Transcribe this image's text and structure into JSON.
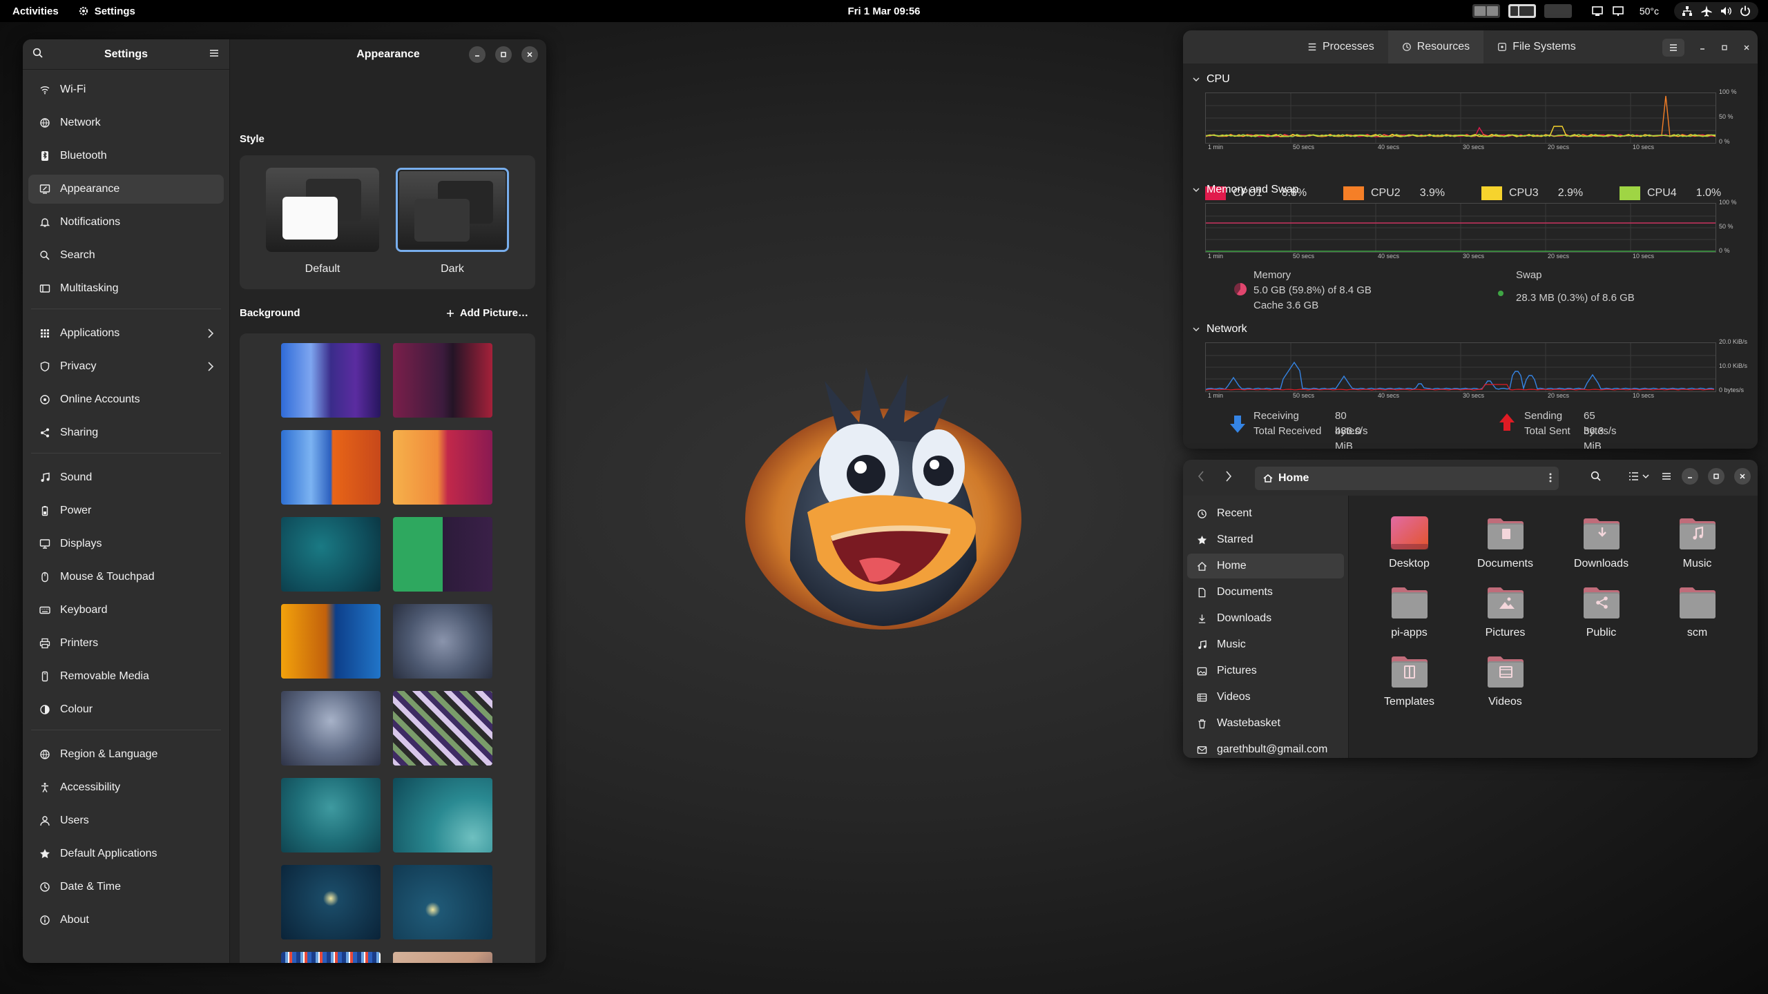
{
  "topbar": {
    "activities": "Activities",
    "app": "Settings",
    "clock": "Fri 1 Mar  09:56",
    "temp": "50°c"
  },
  "settings": {
    "sidebar_title": "Settings",
    "page_title": "Appearance",
    "sidebar": [
      {
        "label": "Wi-Fi",
        "icon": "wifi-icon"
      },
      {
        "label": "Network",
        "icon": "network-icon"
      },
      {
        "label": "Bluetooth",
        "icon": "bluetooth-icon"
      },
      {
        "label": "Appearance",
        "icon": "appearance-icon",
        "selected": true
      },
      {
        "label": "Notifications",
        "icon": "bell-icon"
      },
      {
        "label": "Search",
        "icon": "search-icon"
      },
      {
        "label": "Multitasking",
        "icon": "multitasking-icon"
      },
      {
        "label": "Applications",
        "icon": "applications-icon",
        "chevron": true
      },
      {
        "label": "Privacy",
        "icon": "privacy-icon",
        "chevron": true
      },
      {
        "label": "Online Accounts",
        "icon": "online-accounts-icon"
      },
      {
        "label": "Sharing",
        "icon": "share-icon"
      },
      {
        "label": "Sound",
        "icon": "music-note-icon"
      },
      {
        "label": "Power",
        "icon": "battery-icon"
      },
      {
        "label": "Displays",
        "icon": "display-icon"
      },
      {
        "label": "Mouse & Touchpad",
        "icon": "mouse-icon"
      },
      {
        "label": "Keyboard",
        "icon": "keyboard-icon"
      },
      {
        "label": "Printers",
        "icon": "printer-icon"
      },
      {
        "label": "Removable Media",
        "icon": "usb-icon"
      },
      {
        "label": "Colour",
        "icon": "colour-icon"
      },
      {
        "label": "Region & Language",
        "icon": "globe-icon"
      },
      {
        "label": "Accessibility",
        "icon": "accessibility-icon"
      },
      {
        "label": "Users",
        "icon": "user-icon"
      },
      {
        "label": "Default Applications",
        "icon": "star-icon"
      },
      {
        "label": "Date & Time",
        "icon": "clock-icon"
      },
      {
        "label": "About",
        "icon": "info-icon"
      }
    ],
    "style_label": "Style",
    "style_default": "Default",
    "style_dark": "Dark",
    "background_label": "Background",
    "add_picture": "Add Picture…",
    "selected_style": "Dark"
  },
  "sysmon": {
    "tabs": [
      "Processes",
      "Resources",
      "File Systems"
    ],
    "active_tab": "Resources",
    "cpu_title": "CPU",
    "mem_title": "Memory and Swap",
    "net_title": "Network",
    "pct_labels": [
      "100 %",
      "50 %",
      "0 %"
    ],
    "time_labels": [
      "1 min",
      "50 secs",
      "40 secs",
      "30 secs",
      "20 secs",
      "10 secs"
    ],
    "net_labels": [
      "20.0 KiB/s",
      "10.0 KiB/s",
      "0 bytes/s"
    ],
    "cpus": [
      {
        "name": "CPU1",
        "value": "8.8%",
        "color": "#e01b4c"
      },
      {
        "name": "CPU2",
        "value": "3.9%",
        "color": "#f57f27"
      },
      {
        "name": "CPU3",
        "value": "2.9%",
        "color": "#f6d32d"
      },
      {
        "name": "CPU4",
        "value": "1.0%",
        "color": "#9fd544"
      }
    ],
    "memory": {
      "title": "Memory",
      "line1": "5.0 GB (59.8%) of 8.4 GB",
      "line2": "Cache 3.6 GB",
      "fraction": 0.598
    },
    "swap": {
      "title": "Swap",
      "line1": "28.3 MB (0.3%) of 8.6 GB",
      "fraction": 0.003
    },
    "receiving": {
      "label": "Receiving",
      "rate": "80 bytes/s",
      "total_label": "Total Received",
      "total": "486.0 MiB"
    },
    "sending": {
      "label": "Sending",
      "rate": "65 bytes/s",
      "total_label": "Total Sent",
      "total": "36.3 MiB"
    }
  },
  "files": {
    "location": "Home",
    "sidebar": [
      {
        "label": "Recent",
        "icon": "recent-icon"
      },
      {
        "label": "Starred",
        "icon": "star-icon"
      },
      {
        "label": "Home",
        "icon": "home-icon",
        "selected": true
      },
      {
        "label": "Documents",
        "icon": "document-icon"
      },
      {
        "label": "Downloads",
        "icon": "download-icon"
      },
      {
        "label": "Music",
        "icon": "music-note-icon"
      },
      {
        "label": "Pictures",
        "icon": "picture-icon"
      },
      {
        "label": "Videos",
        "icon": "video-icon"
      },
      {
        "label": "Wastebasket",
        "icon": "trash-icon"
      },
      {
        "label": "garethbult@gmail.com",
        "icon": "online-account-icon"
      }
    ],
    "items": [
      {
        "label": "Desktop",
        "icon": "desktop-folder-icon"
      },
      {
        "label": "Documents",
        "icon": "documents-folder-icon"
      },
      {
        "label": "Downloads",
        "icon": "downloads-folder-icon"
      },
      {
        "label": "Music",
        "icon": "music-folder-icon"
      },
      {
        "label": "pi-apps",
        "icon": "folder-icon"
      },
      {
        "label": "Pictures",
        "icon": "pictures-folder-icon"
      },
      {
        "label": "Public",
        "icon": "public-folder-icon"
      },
      {
        "label": "scm",
        "icon": "folder-icon"
      },
      {
        "label": "Templates",
        "icon": "templates-folder-icon"
      },
      {
        "label": "Videos",
        "icon": "videos-folder-icon"
      }
    ]
  },
  "colors": {
    "accent": "#78aeed",
    "folder": "#e5a0a9",
    "folder_dark": "#c06c7a"
  }
}
